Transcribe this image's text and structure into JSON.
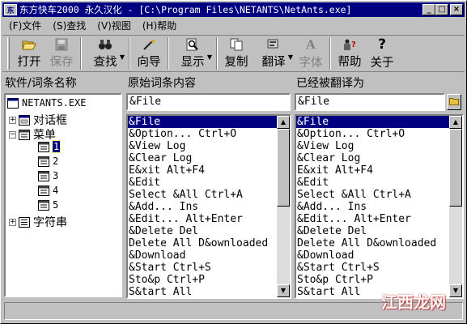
{
  "window": {
    "title": "东方快车2000 永久汉化 - [C:\\Program Files\\NETANTS\\NetAnts.exe]",
    "controls": {
      "minimize": "_",
      "maximize": "□",
      "close": "×"
    }
  },
  "menu": [
    "(F)文件",
    "(S)查找",
    "(V)视图",
    "(H)帮助"
  ],
  "toolbar": {
    "open": "打开",
    "save": "保存",
    "find": "查找",
    "wizard": "向导",
    "display": "显示",
    "copy": "复制",
    "translate": "翻译",
    "font": "字体",
    "help": "帮助",
    "about": "关于",
    "icons": {
      "open": "folder-open-icon",
      "save": "floppy-icon",
      "find": "binoculars-icon",
      "wizard": "magic-wand-icon",
      "display": "magnifier-page-icon",
      "copy": "copy-icon",
      "translate": "translate-icon",
      "font": "font-icon",
      "help": "help-icon",
      "about": "question-icon"
    }
  },
  "panes": {
    "tree_header": "软件/词条名称",
    "source_header": "原始词条内容",
    "target_header": "已经被翻译为"
  },
  "tree": {
    "root": "NETANTS.EXE",
    "dialogs": "对话框",
    "menus": "菜单",
    "menu_children": [
      "1",
      "2",
      "3",
      "4",
      "5"
    ],
    "strings": "字符串"
  },
  "source": {
    "current": "&File",
    "items": [
      "&File",
      "&Option... Ctrl+O",
      "&View Log",
      "&Clear Log",
      "E&xit Alt+F4",
      "&Edit",
      "Select &All Ctrl+A",
      "&Add... Ins",
      "&Edit... Alt+Enter",
      "&Delete Del",
      "Delete All D&ownloaded",
      "&Download",
      "&Start Ctrl+S",
      "Sto&p Ctrl+P",
      "S&tart All"
    ]
  },
  "target": {
    "current": "&File",
    "items": [
      "&File",
      "&Option... Ctrl+O",
      "&View Log",
      "&Clear Log",
      "E&xit Alt+F4",
      "&Edit",
      "Select &All Ctrl+A",
      "&Add... Ins",
      "&Edit... Alt+Enter",
      "&Delete Del",
      "Delete All D&ownloaded",
      "&Download",
      "&Start Ctrl+S",
      "Sto&p Ctrl+P",
      "S&tart All"
    ]
  },
  "watermark": "江西龙网",
  "colors": {
    "selection": "#000080",
    "titlebar": "#000080",
    "face": "#c0c0c0"
  }
}
